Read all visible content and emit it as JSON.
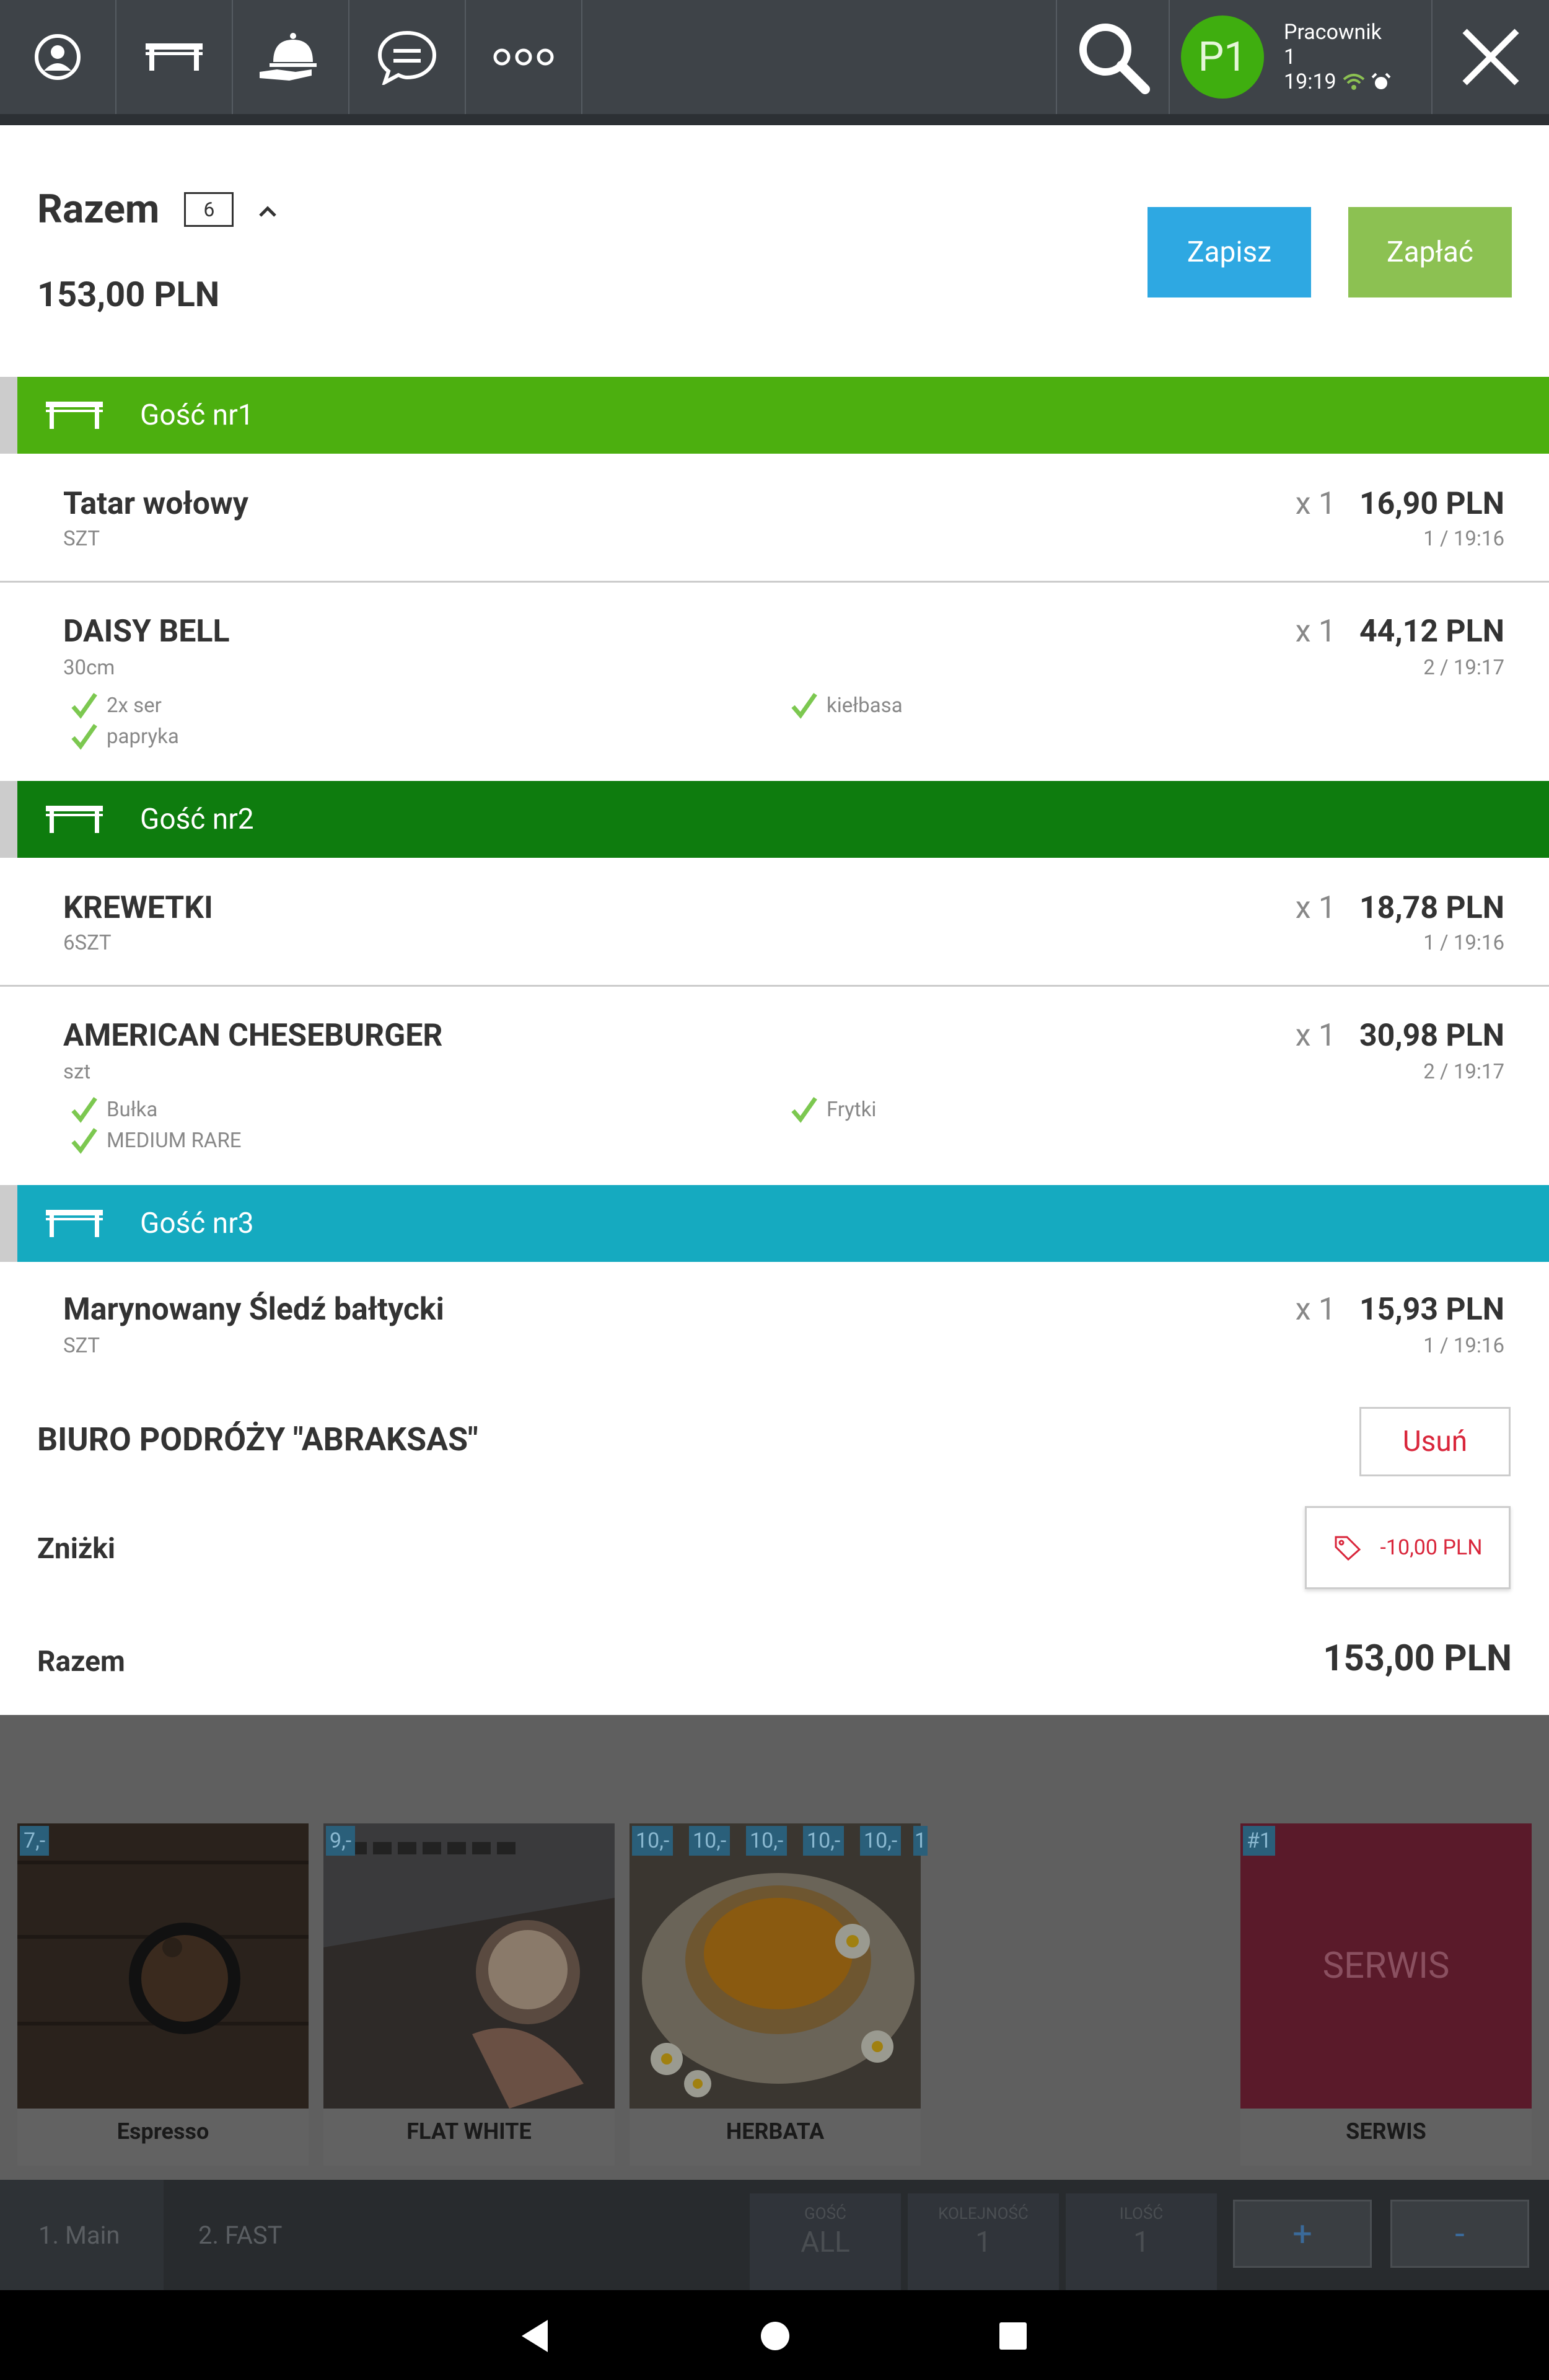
{
  "toolbar": {
    "icons": [
      "user-circle-icon",
      "table-icon",
      "service-bell-icon",
      "chat-icon",
      "more-dots-icon"
    ],
    "search_icon": "search-icon",
    "close_icon": "close-icon",
    "avatar_initials": "P1",
    "worker_label": "Pracownik",
    "worker_number": "1",
    "time": "19:19"
  },
  "summary": {
    "title": "Razem",
    "count": "6",
    "total": "153,00 PLN",
    "save_label": "Zapisz",
    "pay_label": "Zapłać"
  },
  "guests": [
    {
      "label": "Gość nr1",
      "color": "#4caf0f",
      "items": [
        {
          "name": "Tatar wołowy",
          "unit": "SZT",
          "qty": "x 1",
          "price": "16,90 PLN",
          "time": "1 / 19:16",
          "modifiers": []
        },
        {
          "name": "DAISY BELL",
          "unit": "30cm",
          "qty": "x 1",
          "price": "44,12 PLN",
          "time": "2 / 19:17",
          "modifiers": [
            "2x ser",
            "kiełbasa",
            "papryka"
          ]
        }
      ]
    },
    {
      "label": "Gość nr2",
      "color": "#0e7c0e",
      "items": [
        {
          "name": "KREWETKI",
          "unit": "6SZT",
          "qty": "x 1",
          "price": "18,78 PLN",
          "time": "1 / 19:16",
          "modifiers": []
        },
        {
          "name": "AMERICAN CHESEBURGER",
          "unit": "szt",
          "qty": "x 1",
          "price": "30,98 PLN",
          "time": "2 / 19:17",
          "modifiers": [
            "Bułka",
            "Frytki",
            "MEDIUM RARE"
          ]
        }
      ]
    },
    {
      "label": "Gość nr3",
      "color": "#15aac0",
      "items": [
        {
          "name": "Marynowany Śledź bałtycki",
          "unit": "SZT",
          "qty": "x 1",
          "price": "15,93 PLN",
          "time": "1 / 19:16",
          "modifiers": []
        }
      ]
    }
  ],
  "customer": {
    "name": "BIURO PODRÓŻY \"ABRAKSAS\"",
    "remove_label": "Usuń"
  },
  "discounts": {
    "label": "Zniżki",
    "value": "-10,00 PLN"
  },
  "footer_total": {
    "label": "Razem",
    "value": "153,00 PLN"
  },
  "products": [
    {
      "name": "Espresso",
      "badges": [
        "7,-"
      ]
    },
    {
      "name": "FLAT WHITE",
      "badges": [
        "9,-"
      ]
    },
    {
      "name": "HERBATA",
      "badges": [
        "10,-",
        "10,-",
        "10,-",
        "10,-",
        "10,-",
        "1"
      ]
    },
    {
      "name": "SERWIS",
      "badges": [
        "#1"
      ],
      "tile_text": "SERWIS"
    }
  ],
  "controls": {
    "categories": [
      "1. Main",
      "2. FAST"
    ],
    "guest_label": "GOŚĆ",
    "guest_value": "ALL",
    "order_label": "KOLEJNOŚĆ",
    "order_value": "1",
    "qty_label": "ILOŚĆ",
    "qty_value": "1",
    "plus": "+",
    "minus": "-"
  }
}
